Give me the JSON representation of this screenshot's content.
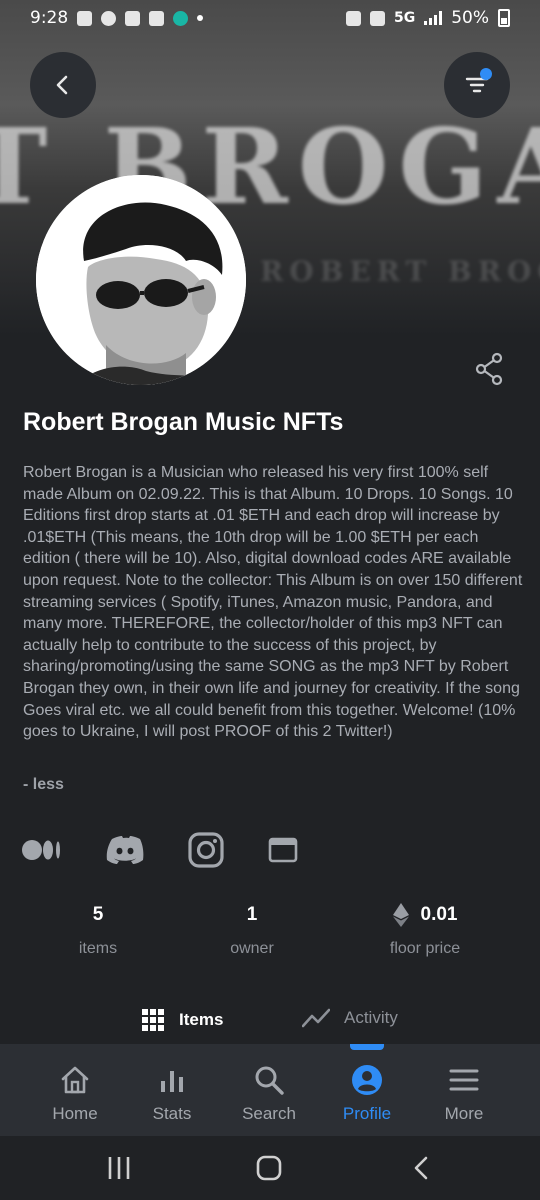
{
  "status_bar": {
    "time": "9:28",
    "network": "5G",
    "battery": "50%"
  },
  "banner": {
    "text": "T BROGAN",
    "subtext": "ROBERT BROGAN"
  },
  "profile": {
    "title": "Robert Brogan Music NFTs",
    "description": "Robert Brogan is a Musician who released his very first 100% self made Album on 02.09.22. This is that Album. 10 Drops. 10 Songs. 10 Editions first drop starts at .01 $ETH and each drop will increase by .01$ETH (This means, the 10th drop will be 1.00 $ETH per each edition ( there will be 10). Also, digital download codes ARE available upon request. Note to the collector: This Album is on over 150 different streaming services ( Spotify, iTunes, Amazon music, Pandora, and many more. THEREFORE, the collector/holder of this mp3 NFT can actually help to contribute to the success of this project, by sharing/promoting/using the same SONG as the mp3 NFT by Robert Brogan they own, in their own life and journey for creativity. If the song Goes viral etc. we all could benefit from this together. Welcome! (10% goes to Ukraine, I will post PROOF of this 2 Twitter!)",
    "less_label": "- less"
  },
  "socials": [
    "medium-icon",
    "discord-icon",
    "instagram-icon",
    "website-icon"
  ],
  "stats": {
    "items": {
      "value": "5",
      "label": "items"
    },
    "owners": {
      "value": "1",
      "label": "owner"
    },
    "floor": {
      "value": "0.01",
      "label": "floor price"
    }
  },
  "tabs": {
    "items": "Items",
    "activity": "Activity"
  },
  "bottom_nav": {
    "home": "Home",
    "stats": "Stats",
    "search": "Search",
    "profile": "Profile",
    "more": "More"
  },
  "colors": {
    "accent": "#2f8cf5",
    "background": "#202225",
    "nav_background": "#2c2f34"
  }
}
